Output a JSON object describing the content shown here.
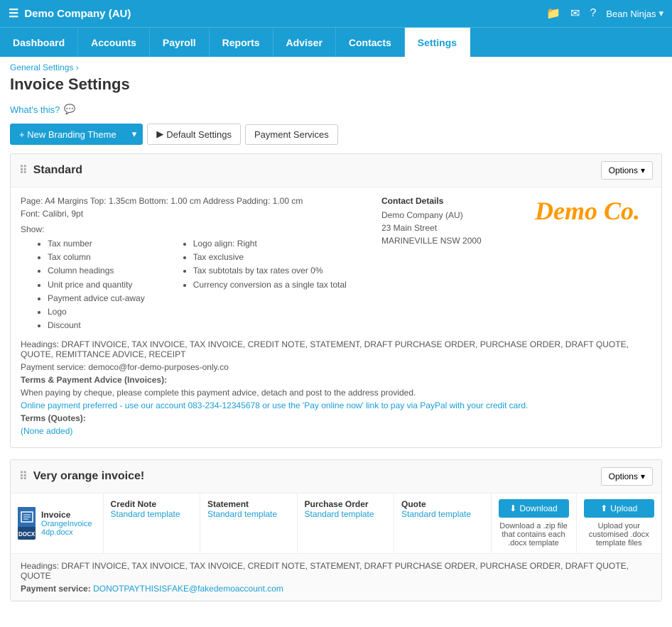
{
  "topbar": {
    "company": "Demo Company (AU)",
    "user": "Bean Ninjas",
    "user_arrow": "▾"
  },
  "nav": {
    "items": [
      {
        "id": "dashboard",
        "label": "Dashboard",
        "active": false
      },
      {
        "id": "accounts",
        "label": "Accounts",
        "active": false
      },
      {
        "id": "payroll",
        "label": "Payroll",
        "active": false
      },
      {
        "id": "reports",
        "label": "Reports",
        "active": false
      },
      {
        "id": "adviser",
        "label": "Adviser",
        "active": false
      },
      {
        "id": "contacts",
        "label": "Contacts",
        "active": false
      },
      {
        "id": "settings",
        "label": "Settings",
        "active": true
      }
    ]
  },
  "breadcrumb": {
    "parent": "General Settings",
    "separator": "›",
    "current": "Invoice Settings"
  },
  "page": {
    "title": "Invoice Settings",
    "whats_this": "What's this?"
  },
  "buttons": {
    "new_branding": "+ New Branding Theme",
    "new_branding_arrow": "▾",
    "default_settings": "Default Settings",
    "payment_services": "Payment Services"
  },
  "standard_card": {
    "title": "Standard",
    "options_label": "Options",
    "page_info": "Page: A4  Margins Top: 1.35cm Bottom: 1.00 cm Address Padding: 1.00 cm",
    "font_info": "Font: Calibri, 9pt",
    "show_label": "Show:",
    "show_col1": [
      "Tax number",
      "Tax column",
      "Column headings",
      "Unit price and quantity",
      "Payment advice cut-away",
      "Logo",
      "Discount"
    ],
    "show_col2": [
      "Logo align: Right",
      "Tax exclusive",
      "Tax subtotals by tax rates over 0%",
      "Currency conversion as a single tax total"
    ],
    "contact_details_title": "Contact Details",
    "contact_name": "Demo Company (AU)",
    "contact_address": "23 Main Street",
    "contact_city": "MARINEVILLE NSW 2000",
    "logo_text": "Demo Co.",
    "headings_text": "Headings: DRAFT INVOICE, TAX INVOICE, TAX INVOICE, CREDIT NOTE, STATEMENT, DRAFT PURCHASE ORDER, PURCHASE ORDER, DRAFT QUOTE, QUOTE, REMITTANCE ADVICE, RECEIPT",
    "payment_service": "Payment service: democo@for-demo-purposes-only.co",
    "terms_label": "Terms & Payment Advice (Invoices):",
    "terms_text": "When paying by cheque, please complete this payment advice, detach and post to the address provided.",
    "online_payment_text": "Online payment preferred - use our account 083-234-12345678 or use the 'Pay online now' link to pay via PayPal with your credit card.",
    "terms_quotes_label": "Terms (Quotes):",
    "terms_quotes_value": "(None added)"
  },
  "orange_card": {
    "title": "Very orange invoice!",
    "options_label": "Options",
    "invoice_label": "Invoice",
    "invoice_file": "OrangeInvoice4dp.docx",
    "credit_note_label": "Credit Note",
    "credit_note_sub": "Standard template",
    "statement_label": "Statement",
    "statement_sub": "Standard template",
    "purchase_order_label": "Purchase Order",
    "purchase_order_sub": "Standard template",
    "quote_label": "Quote",
    "quote_sub": "Standard template",
    "download_btn": "Download",
    "download_desc": "Download a .zip file that contains each .docx template",
    "upload_btn": "Upload",
    "upload_desc": "Upload your customised .docx template files",
    "footer_headings": "Headings: DRAFT INVOICE, TAX INVOICE, TAX INVOICE, CREDIT NOTE, STATEMENT, DRAFT PURCHASE ORDER, PURCHASE ORDER, DRAFT QUOTE, QUOTE",
    "footer_payment_label": "Payment service:",
    "footer_payment_email": "DONOTPAYTHISISFAKE@fakedemoaccount.com"
  }
}
